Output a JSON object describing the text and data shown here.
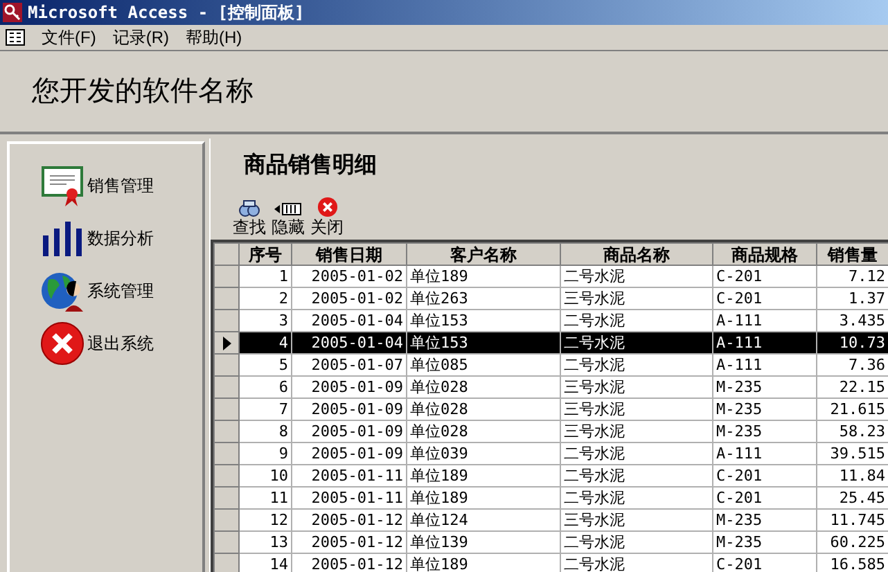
{
  "window": {
    "title": "Microsoft Access - [控制面板]"
  },
  "menu": [
    "文件(F)",
    "记录(R)",
    "帮助(H)"
  ],
  "header": {
    "title": "您开发的软件名称"
  },
  "sidebar": {
    "items": [
      {
        "label": "销售管理",
        "kind": "certificate"
      },
      {
        "label": "数据分析",
        "kind": "bars"
      },
      {
        "label": "系统管理",
        "kind": "globe"
      },
      {
        "label": "退出系统",
        "kind": "exit"
      }
    ]
  },
  "panel": {
    "title": "商品销售明细"
  },
  "toolbar": [
    {
      "label": "查找",
      "kind": "find"
    },
    {
      "label": "隐藏",
      "kind": "hide"
    },
    {
      "label": "关闭",
      "kind": "close"
    }
  ],
  "table": {
    "columns": [
      "序号",
      "销售日期",
      "客户名称",
      "商品名称",
      "商品规格",
      "销售量"
    ],
    "rows": [
      {
        "cells": [
          "1",
          "2005-01-02",
          "单位189",
          "二号水泥",
          "C-201",
          "7.12"
        ],
        "selected": false
      },
      {
        "cells": [
          "2",
          "2005-01-02",
          "单位263",
          "三号水泥",
          "C-201",
          "1.37"
        ],
        "selected": false
      },
      {
        "cells": [
          "3",
          "2005-01-04",
          "单位153",
          "二号水泥",
          "A-111",
          "3.435"
        ],
        "selected": false
      },
      {
        "cells": [
          "4",
          "2005-01-04",
          "单位153",
          "二号水泥",
          "A-111",
          "10.73"
        ],
        "selected": true
      },
      {
        "cells": [
          "5",
          "2005-01-07",
          "单位085",
          "二号水泥",
          "A-111",
          "7.36"
        ],
        "selected": false
      },
      {
        "cells": [
          "6",
          "2005-01-09",
          "单位028",
          "三号水泥",
          "M-235",
          "22.15"
        ],
        "selected": false
      },
      {
        "cells": [
          "7",
          "2005-01-09",
          "单位028",
          "三号水泥",
          "M-235",
          "21.615"
        ],
        "selected": false
      },
      {
        "cells": [
          "8",
          "2005-01-09",
          "单位028",
          "三号水泥",
          "M-235",
          "58.23"
        ],
        "selected": false
      },
      {
        "cells": [
          "9",
          "2005-01-09",
          "单位039",
          "二号水泥",
          "A-111",
          "39.515"
        ],
        "selected": false
      },
      {
        "cells": [
          "10",
          "2005-01-11",
          "单位189",
          "二号水泥",
          "C-201",
          "11.84"
        ],
        "selected": false
      },
      {
        "cells": [
          "11",
          "2005-01-11",
          "单位189",
          "二号水泥",
          "C-201",
          "25.45"
        ],
        "selected": false
      },
      {
        "cells": [
          "12",
          "2005-01-12",
          "单位124",
          "三号水泥",
          "M-235",
          "11.745"
        ],
        "selected": false
      },
      {
        "cells": [
          "13",
          "2005-01-12",
          "单位139",
          "二号水泥",
          "M-235",
          "60.225"
        ],
        "selected": false
      },
      {
        "cells": [
          "14",
          "2005-01-12",
          "单位189",
          "二号水泥",
          "C-201",
          "16.585"
        ],
        "selected": false
      }
    ]
  }
}
